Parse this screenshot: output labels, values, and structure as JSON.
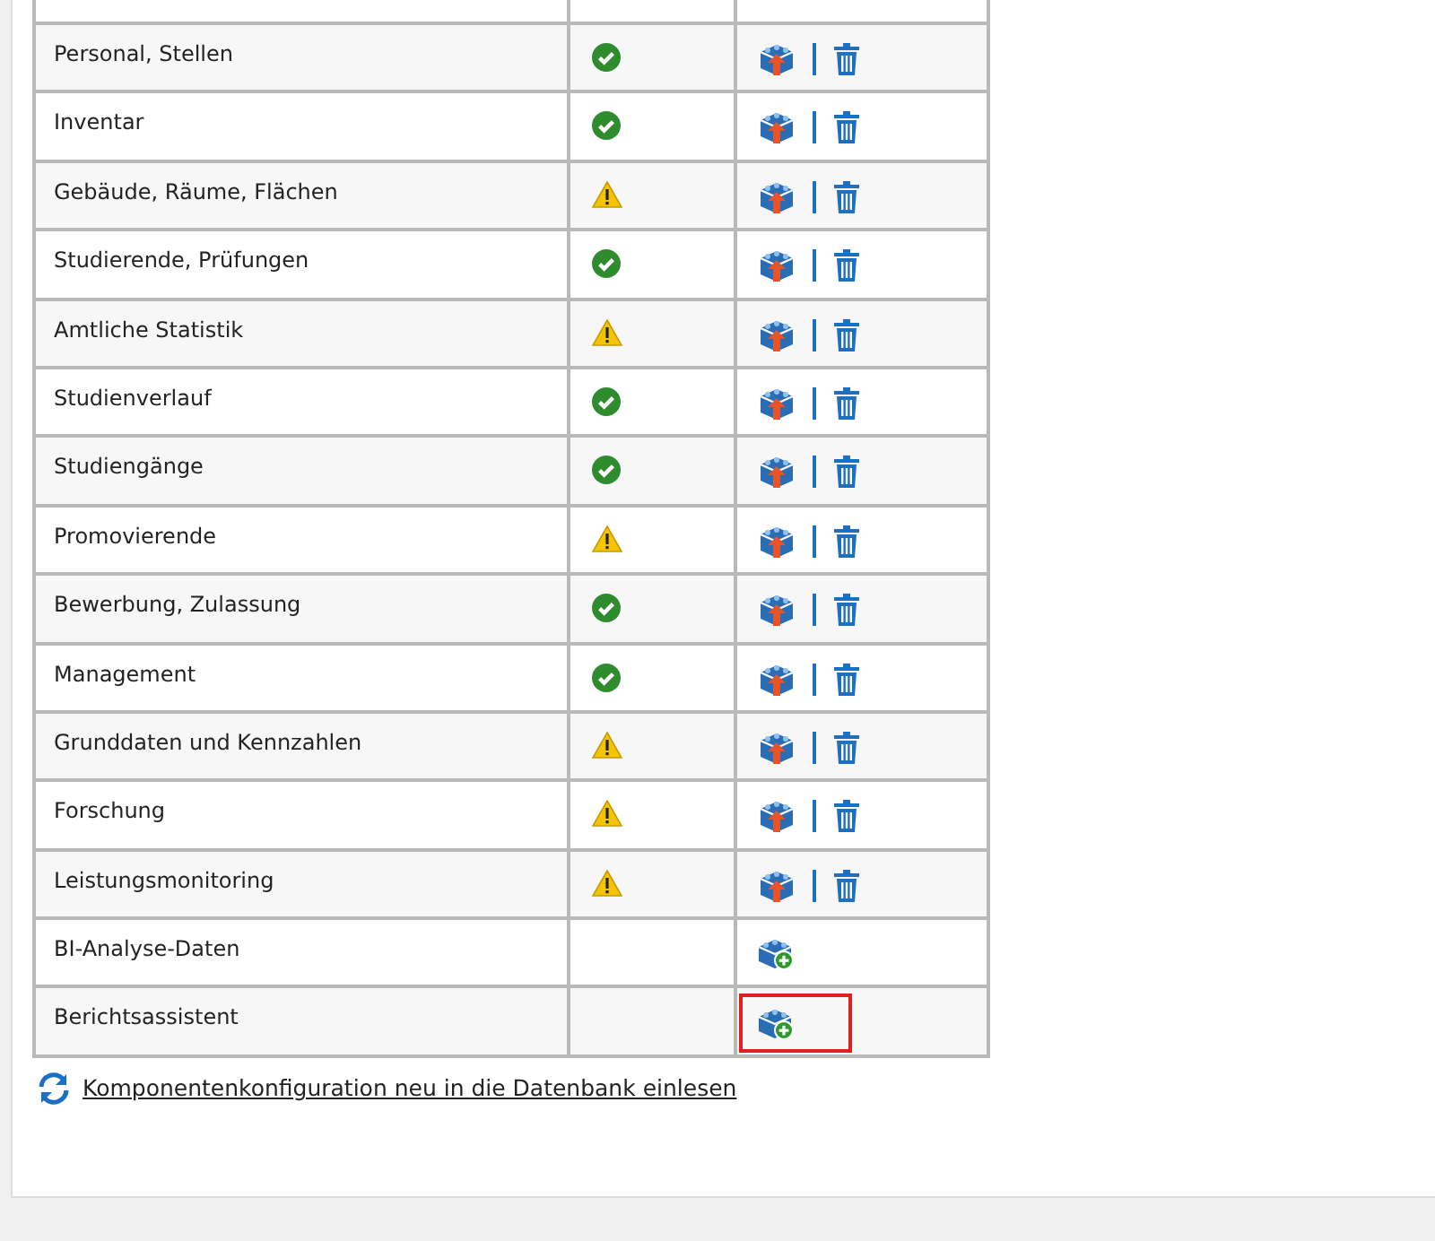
{
  "components": [
    {
      "name": "Personal, Stellen",
      "status": {
        "kind": "ok"
      },
      "kind": "installed",
      "highlighted": false
    },
    {
      "name": "Inventar",
      "status": {
        "kind": "ok"
      },
      "kind": "installed",
      "highlighted": false
    },
    {
      "name": "Gebäude, Räume, Flächen",
      "status": {
        "kind": "warning"
      },
      "kind": "installed",
      "highlighted": false
    },
    {
      "name": "Studierende, Prüfungen",
      "status": {
        "kind": "ok"
      },
      "kind": "installed",
      "highlighted": false
    },
    {
      "name": "Amtliche Statistik",
      "status": {
        "kind": "warning"
      },
      "kind": "installed",
      "highlighted": false
    },
    {
      "name": "Studienverlauf",
      "status": {
        "kind": "ok"
      },
      "kind": "installed",
      "highlighted": false
    },
    {
      "name": "Studiengänge",
      "status": {
        "kind": "ok"
      },
      "kind": "installed",
      "highlighted": false
    },
    {
      "name": "Promovierende",
      "status": {
        "kind": "warning"
      },
      "kind": "installed",
      "highlighted": false
    },
    {
      "name": "Bewerbung, Zulassung",
      "status": {
        "kind": "ok"
      },
      "kind": "installed",
      "highlighted": false
    },
    {
      "name": "Management",
      "status": {
        "kind": "ok"
      },
      "kind": "installed",
      "highlighted": false
    },
    {
      "name": "Grunddaten und Kennzahlen",
      "status": {
        "kind": "warning"
      },
      "kind": "installed",
      "highlighted": false
    },
    {
      "name": "Forschung",
      "status": {
        "kind": "warning"
      },
      "kind": "installed",
      "highlighted": false
    },
    {
      "name": "Leistungsmonitoring",
      "status": {
        "kind": "warning"
      },
      "kind": "installed",
      "highlighted": false
    },
    {
      "name": "BI-Analyse-Daten",
      "kind": "available",
      "highlighted": false
    },
    {
      "name": "Berichtsassistent",
      "kind": "available",
      "highlighted": true
    }
  ],
  "reload_link": "Komponentenkonfiguration neu in die Datenbank einlesen"
}
